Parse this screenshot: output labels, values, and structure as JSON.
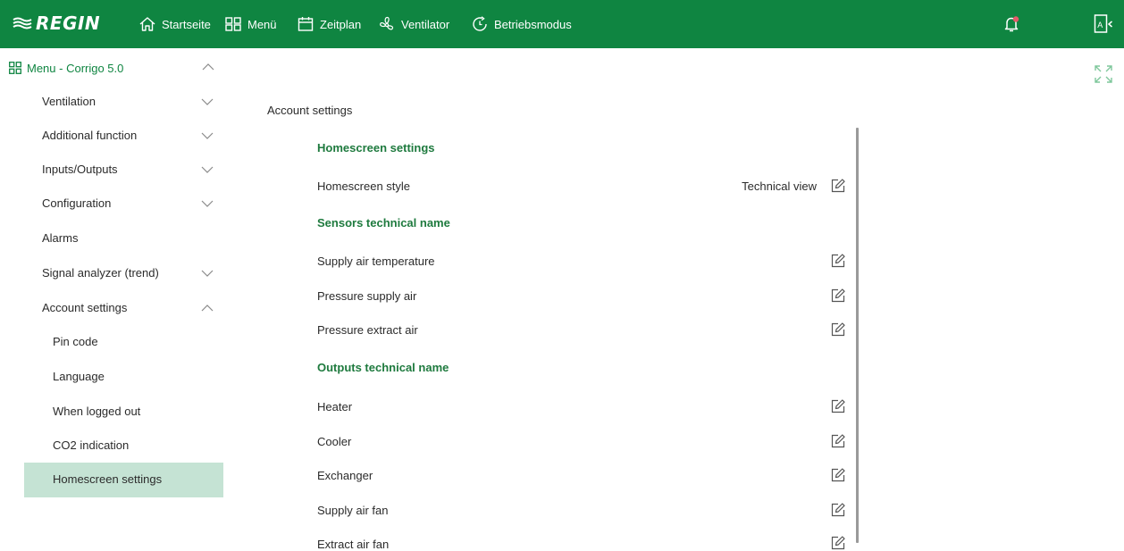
{
  "topbar": {
    "brand": "REGIN",
    "nav": [
      {
        "label": "Startseite",
        "icon": "home-icon"
      },
      {
        "label": "Menü",
        "icon": "grid-icon"
      },
      {
        "label": "Zeitplan",
        "icon": "calendar-icon"
      },
      {
        "label": "Ventilator",
        "icon": "fan-icon"
      },
      {
        "label": "Betriebsmodus",
        "icon": "mode-clock-icon"
      }
    ],
    "colors": {
      "bar": "#0f8541",
      "text": "#ffffff",
      "notification_dot": "#e55a6a"
    }
  },
  "sidebar": {
    "root_label": "Menu - Corrigo 5.0",
    "items": [
      {
        "label": "Ventilation",
        "expandable": true,
        "expanded": false
      },
      {
        "label": "Additional function",
        "expandable": true,
        "expanded": false
      },
      {
        "label": "Inputs/Outputs",
        "expandable": true,
        "expanded": false
      },
      {
        "label": "Configuration",
        "expandable": true,
        "expanded": false
      },
      {
        "label": "Alarms",
        "expandable": false
      },
      {
        "label": "Signal analyzer (trend)",
        "expandable": true,
        "expanded": false
      },
      {
        "label": "Account settings",
        "expandable": true,
        "expanded": true
      }
    ],
    "subitems": [
      {
        "label": "Pin code"
      },
      {
        "label": "Language"
      },
      {
        "label": "When logged out"
      },
      {
        "label": "CO2 indication"
      },
      {
        "label": "Homescreen settings",
        "active": true
      }
    ],
    "colors": {
      "active_bg": "#c5e3d4",
      "accent": "#0f8541"
    }
  },
  "main": {
    "section_title": "Account settings",
    "groups": [
      {
        "title": "Homescreen settings",
        "rows": [
          {
            "label": "Homescreen style",
            "value": "Technical view"
          }
        ]
      },
      {
        "title": "Sensors technical name",
        "rows": [
          {
            "label": "Supply air temperature",
            "value": ""
          },
          {
            "label": "Pressure supply air",
            "value": ""
          },
          {
            "label": "Pressure extract air",
            "value": ""
          }
        ]
      },
      {
        "title": "Outputs technical name",
        "rows": [
          {
            "label": "Heater",
            "value": ""
          },
          {
            "label": "Cooler",
            "value": ""
          },
          {
            "label": "Exchanger",
            "value": ""
          },
          {
            "label": "Supply air fan",
            "value": ""
          },
          {
            "label": "Extract air fan",
            "value": ""
          }
        ]
      }
    ]
  }
}
